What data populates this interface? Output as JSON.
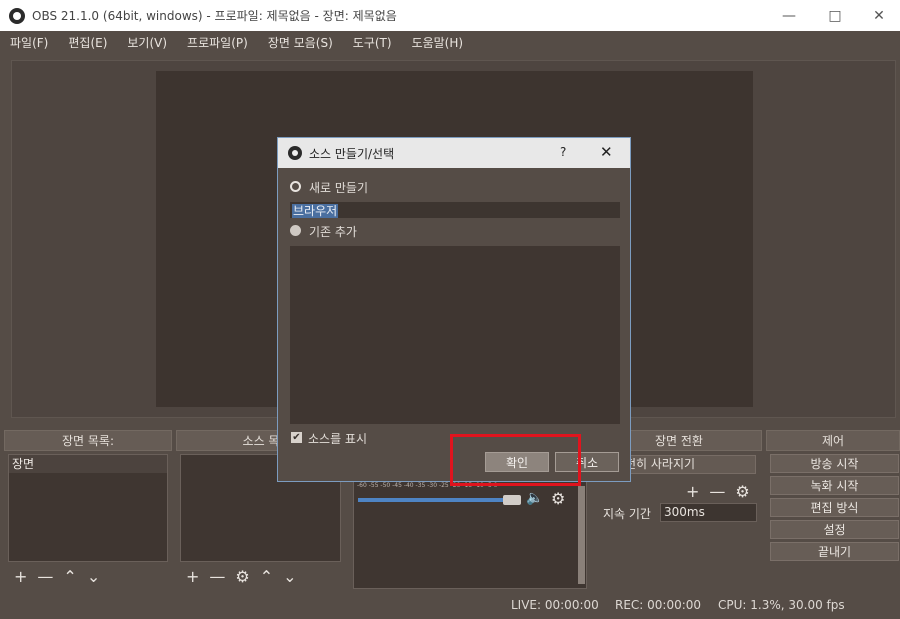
{
  "window": {
    "title": "OBS 21.1.0 (64bit, windows) - 프로파일: 제목없음 - 장면: 제목없음"
  },
  "menu": [
    "파일(F)",
    "편집(E)",
    "보기(V)",
    "프로파일(P)",
    "장면 모음(S)",
    "도구(T)",
    "도움말(H)"
  ],
  "docks": {
    "scenes_title": "장면 목록:",
    "sources_title": "소스 목",
    "transitions_title": "장면 전환",
    "controls_title": "제어"
  },
  "scenes": {
    "items": [
      "장면"
    ]
  },
  "transitions": {
    "selected": "전히 사라지기",
    "duration_label": "지속 기간",
    "duration_value": "300ms"
  },
  "controls": {
    "buttons": [
      "방송 시작",
      "녹화 시작",
      "편집 방식",
      "설정",
      "끝내기"
    ]
  },
  "mixer": {
    "scale": "-60 -55 -50 -45 -40 -35 -30 -25 -20 -15 -10 -5 0"
  },
  "status": {
    "live": "LIVE: 00:00:00",
    "rec": "REC: 00:00:00",
    "cpu": "CPU: 1.3%, 30.00 fps"
  },
  "dialog": {
    "title": "소스 만들기/선택",
    "help": "?",
    "new_label": "새로 만들기",
    "name_value": "브라우저",
    "existing_label": "기존 추가",
    "show_source_label": "소스를 표시",
    "ok_label": "확인",
    "cancel_label": "취소"
  },
  "colors": {
    "highlight": "#e0141e",
    "accent": "#4e84c4"
  }
}
